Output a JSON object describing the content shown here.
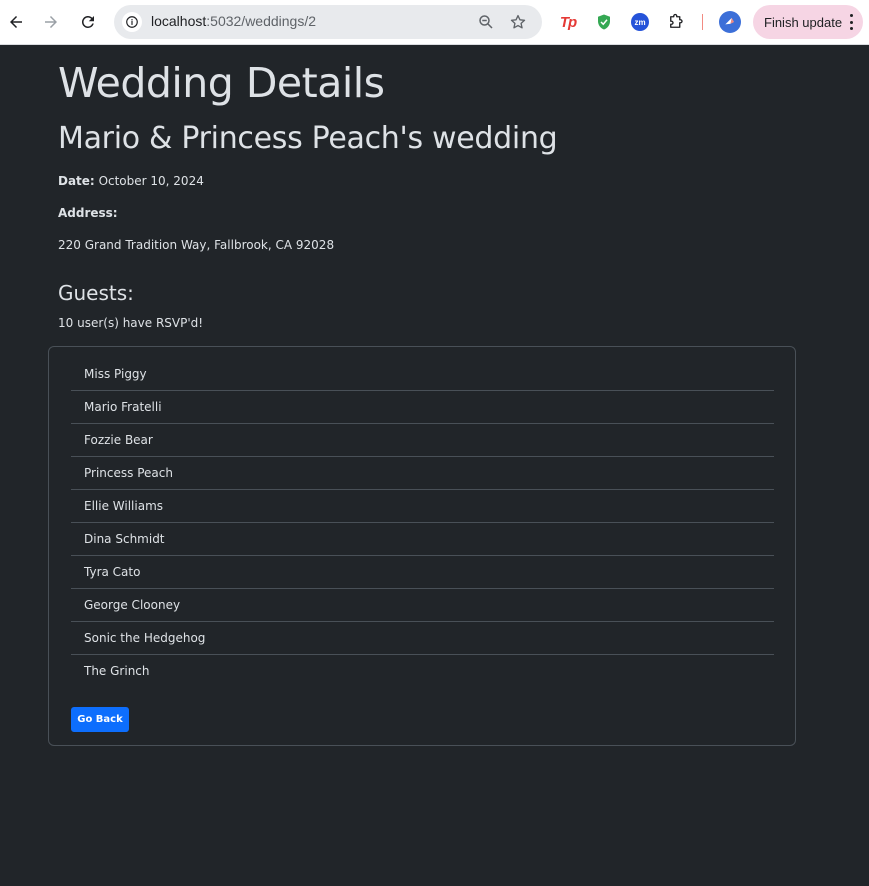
{
  "browser": {
    "url_host": "localhost",
    "url_path": ":5032/weddings/2",
    "update_label": "Finish update",
    "extensions": [
      "tp-extension-icon",
      "shield-extension-icon",
      "zm-extension-icon",
      "puzzle-icon"
    ],
    "ext_tp_label": "Tp",
    "ext_zm_label": "zm"
  },
  "page": {
    "title": "Wedding Details",
    "wedding_name": "Mario & Princess Peach's wedding",
    "date_label": "Date:",
    "date_value": "October 10, 2024",
    "address_label": "Address:",
    "address_value": "220 Grand Tradition Way, Fallbrook, CA 92028",
    "guests_title": "Guests:",
    "rsvp_text": "10 user(s) have RSVP'd!",
    "guests": [
      "Miss Piggy",
      "Mario Fratelli",
      "Fozzie Bear",
      "Princess Peach",
      "Ellie Williams",
      "Dina Schmidt",
      "Tyra Cato",
      "George Clooney",
      "Sonic the Hedgehog",
      "The Grinch"
    ],
    "back_button_label": "Go Back"
  },
  "colors": {
    "background": "#212529",
    "text": "#dee2e6",
    "border": "#495057",
    "primary": "#0d6efd"
  }
}
